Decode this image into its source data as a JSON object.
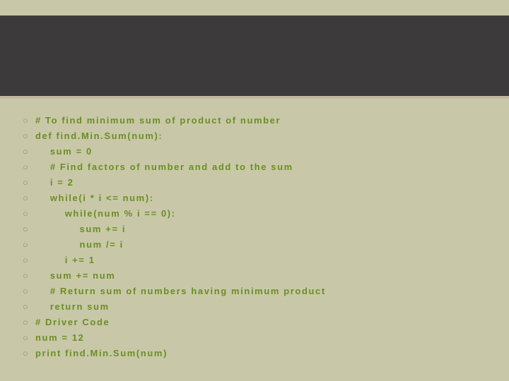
{
  "lines": [
    "# To find minimum sum of product of number",
    "def find.Min.Sum(num):",
    "    sum = 0",
    "    # Find factors of number and add to the sum",
    "    i = 2",
    "    while(i * i <= num):",
    "        while(num % i == 0):",
    "            sum += i",
    "            num /= i",
    "        i += 1",
    "    sum += num",
    "    # Return sum of numbers having minimum product",
    "    return sum",
    "# Driver Code",
    "num = 12",
    "print find.Min.Sum(num)"
  ]
}
